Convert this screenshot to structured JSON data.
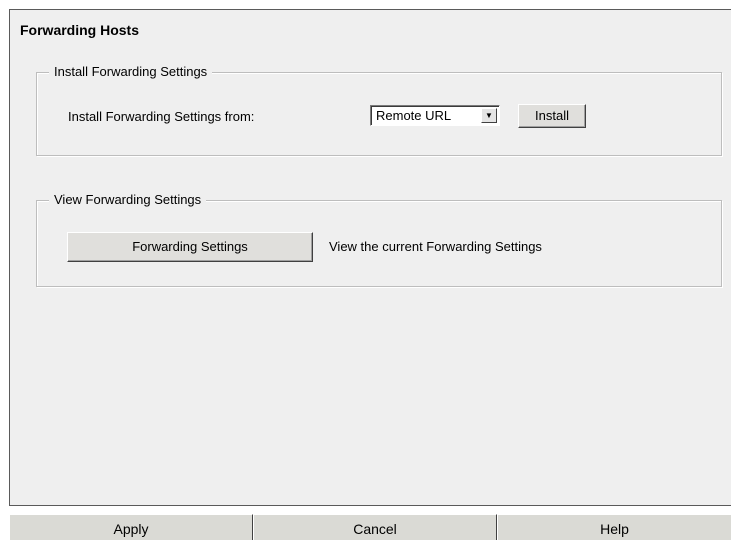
{
  "panel": {
    "title": "Forwarding Hosts"
  },
  "install_group": {
    "legend": "Install Forwarding Settings",
    "from_label": "Install Forwarding Settings from:",
    "source_select": {
      "selected": "Remote URL"
    },
    "install_button": "Install"
  },
  "view_group": {
    "legend": "View Forwarding Settings",
    "settings_button": "Forwarding Settings",
    "description": "View the current Forwarding Settings"
  },
  "footer": {
    "apply": "Apply",
    "cancel": "Cancel",
    "help": "Help"
  },
  "icons": {
    "dropdown": "chevron-down-icon"
  },
  "colors": {
    "panel_bg": "#efefef",
    "button_face": "#e0dfdc"
  }
}
